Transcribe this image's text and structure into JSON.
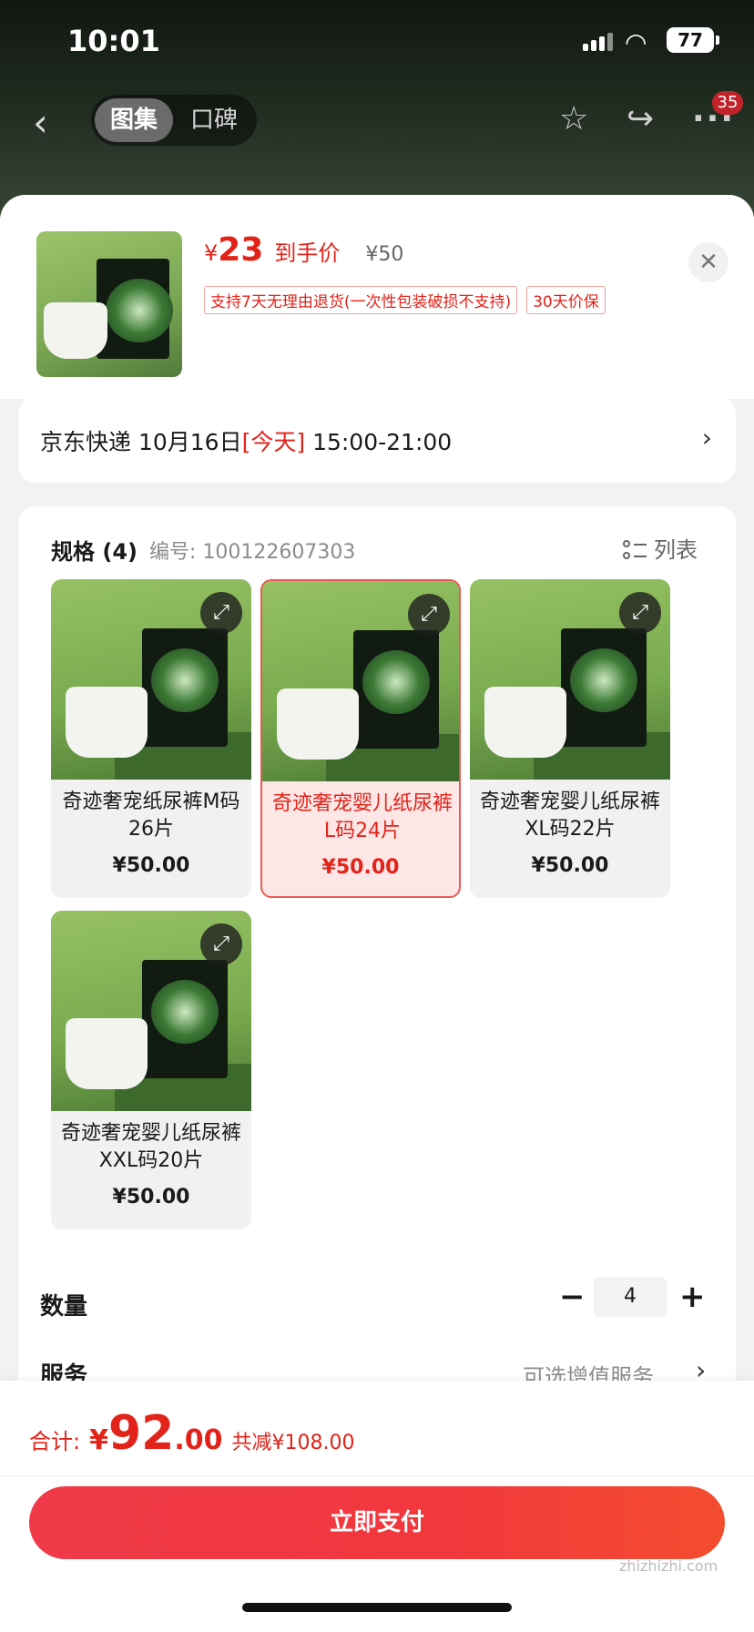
{
  "status": {
    "time": "10:01",
    "battery": "77"
  },
  "nav": {
    "tabs": [
      "图集",
      "口碑"
    ],
    "badge": "35"
  },
  "product": {
    "price_yen": "¥",
    "price_value": "23",
    "price_label": "到手价",
    "original_price": "¥50",
    "tags": [
      "支持7天无理由退货(一次性包装破损不支持)",
      "30天价保"
    ]
  },
  "delivery": {
    "carrier": "京东快递",
    "date": "10月16日",
    "today": "[今天]",
    "window": "15:00-21:00"
  },
  "spec": {
    "title": "规格 (4)",
    "code_label": "编号: 100122607303",
    "list_label": "列表",
    "options": [
      {
        "name": "奇迹奢宠纸尿裤M码26片",
        "price": "¥50.00"
      },
      {
        "name": "奇迹奢宠婴儿纸尿裤L码24片",
        "price": "¥50.00"
      },
      {
        "name": "奇迹奢宠婴儿纸尿裤XL码22片",
        "price": "¥50.00"
      },
      {
        "name": "奇迹奢宠婴儿纸尿裤XXL码20片",
        "price": "¥50.00"
      }
    ],
    "selected_index": 1
  },
  "quantity": {
    "label": "数量",
    "value": "4"
  },
  "service": {
    "label": "服务",
    "value": "可选增值服务"
  },
  "total": {
    "label": "合计:",
    "yen": "¥",
    "int": "92",
    "dec": ".00",
    "saving": "共减¥108.00"
  },
  "pay_button": "立即支付",
  "watermark": "zhizhizhi.com"
}
